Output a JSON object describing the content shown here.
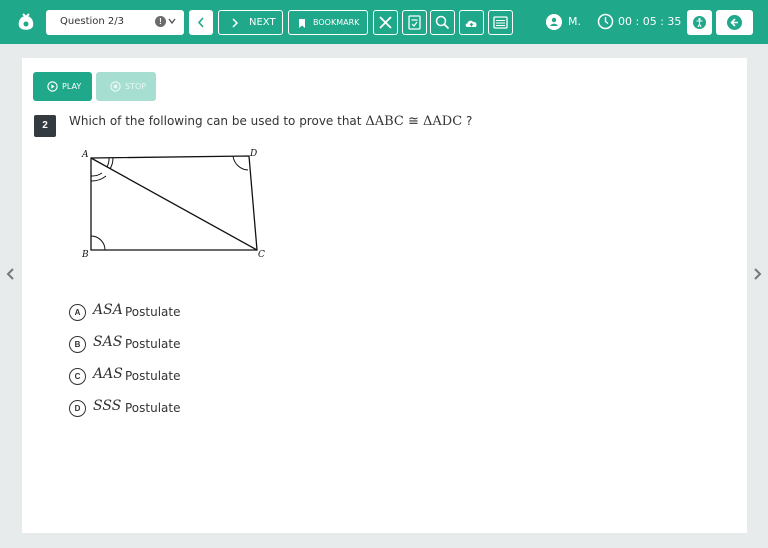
{
  "colors": {
    "accent": "#1fa88a",
    "accent_light": "#a7ded2",
    "dark": "#333a40"
  },
  "toolbar": {
    "question_selector": "Question 2/3",
    "next_label": "NEXT",
    "bookmark_label": "BOOKMARK",
    "tools": [
      "close-icon",
      "calculator-icon",
      "magnifier-icon",
      "cloud-upload-icon",
      "reference-icon"
    ],
    "user_name": "M.",
    "timer": "00 : 05 : 35"
  },
  "media": {
    "play_label": "PLAY",
    "stop_label": "STOP"
  },
  "question": {
    "number": "2",
    "text": "Which of the following can be used to prove that",
    "math": "ΔABC ≅ ΔADC",
    "suffix": "?",
    "figure_labels": {
      "a": "A",
      "b": "B",
      "c": "C",
      "d": "D"
    }
  },
  "choices": [
    {
      "letter": "A",
      "math": "ASA",
      "text": "Postulate"
    },
    {
      "letter": "B",
      "math": "SAS",
      "text": "Postulate"
    },
    {
      "letter": "C",
      "math": "AAS",
      "text": "Postulate"
    },
    {
      "letter": "D",
      "math": "SSS",
      "text": "Postulate"
    }
  ]
}
